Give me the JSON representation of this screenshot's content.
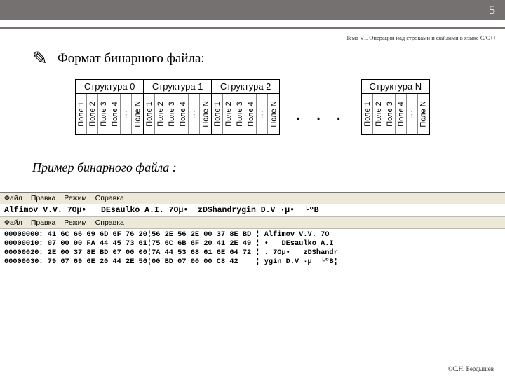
{
  "page_number": "5",
  "topic": "Тема VI. Операции над строками и файлами в языке С/С++",
  "title": "Формат бинарного файла:",
  "pencil_icon": "✎",
  "structures": [
    {
      "header": "Структура 0",
      "fields": [
        "Поле 1",
        "Поле 2",
        "Поле 3",
        "Поле 4",
        "⋮",
        "Поле N"
      ]
    },
    {
      "header": "Структура 1",
      "fields": [
        "Поле 1",
        "Поле 2",
        "Поле 3",
        "Поле 4",
        "⋮",
        "Поле N"
      ]
    },
    {
      "header": "Структура 2",
      "fields": [
        "Поле 1",
        "Поле 2",
        "Поле 3",
        "Поле 4",
        "⋮",
        "Поле N"
      ]
    }
  ],
  "structure_last": {
    "header": "Структура N",
    "fields": [
      "Поле 1",
      "Поле 2",
      "Поле 3",
      "Поле 4",
      "⋮",
      "Поле N"
    ]
  },
  "gap_dots": ". . .",
  "subtitle": "Пример бинарного файла :",
  "hex_view": {
    "menu": [
      "Файл",
      "Правка",
      "Режим",
      "Справка"
    ],
    "text_preview": "Alfimov V.V. 7Oµ•   DEsaulko A.I. 7Oµ•  zDShandrygin D.V ·µ•  └ºB",
    "rows": [
      "00000000: 41 6C 66 69 6D 6F 76 20¦56 2E 56 2E 00 37 8E BD ¦ Alfimov V.V. 7O",
      "00000010: 07 00 00 FA 44 45 73 61¦75 6C 6B 6F 20 41 2E 49 ¦ •   DEsaulko A.I",
      "00000020: 2E 00 37 8E BD 07 00 00¦7A 44 53 68 61 6E 64 72 ¦ . 7Oµ•   zDShandr",
      "00000030: 79 67 69 6E 20 44 2E 56¦00 BD 07 00 00 C8 42    ¦ ygin D.V ·µ  └ºB¦"
    ]
  },
  "footer": "©С.Н. Бердышев"
}
